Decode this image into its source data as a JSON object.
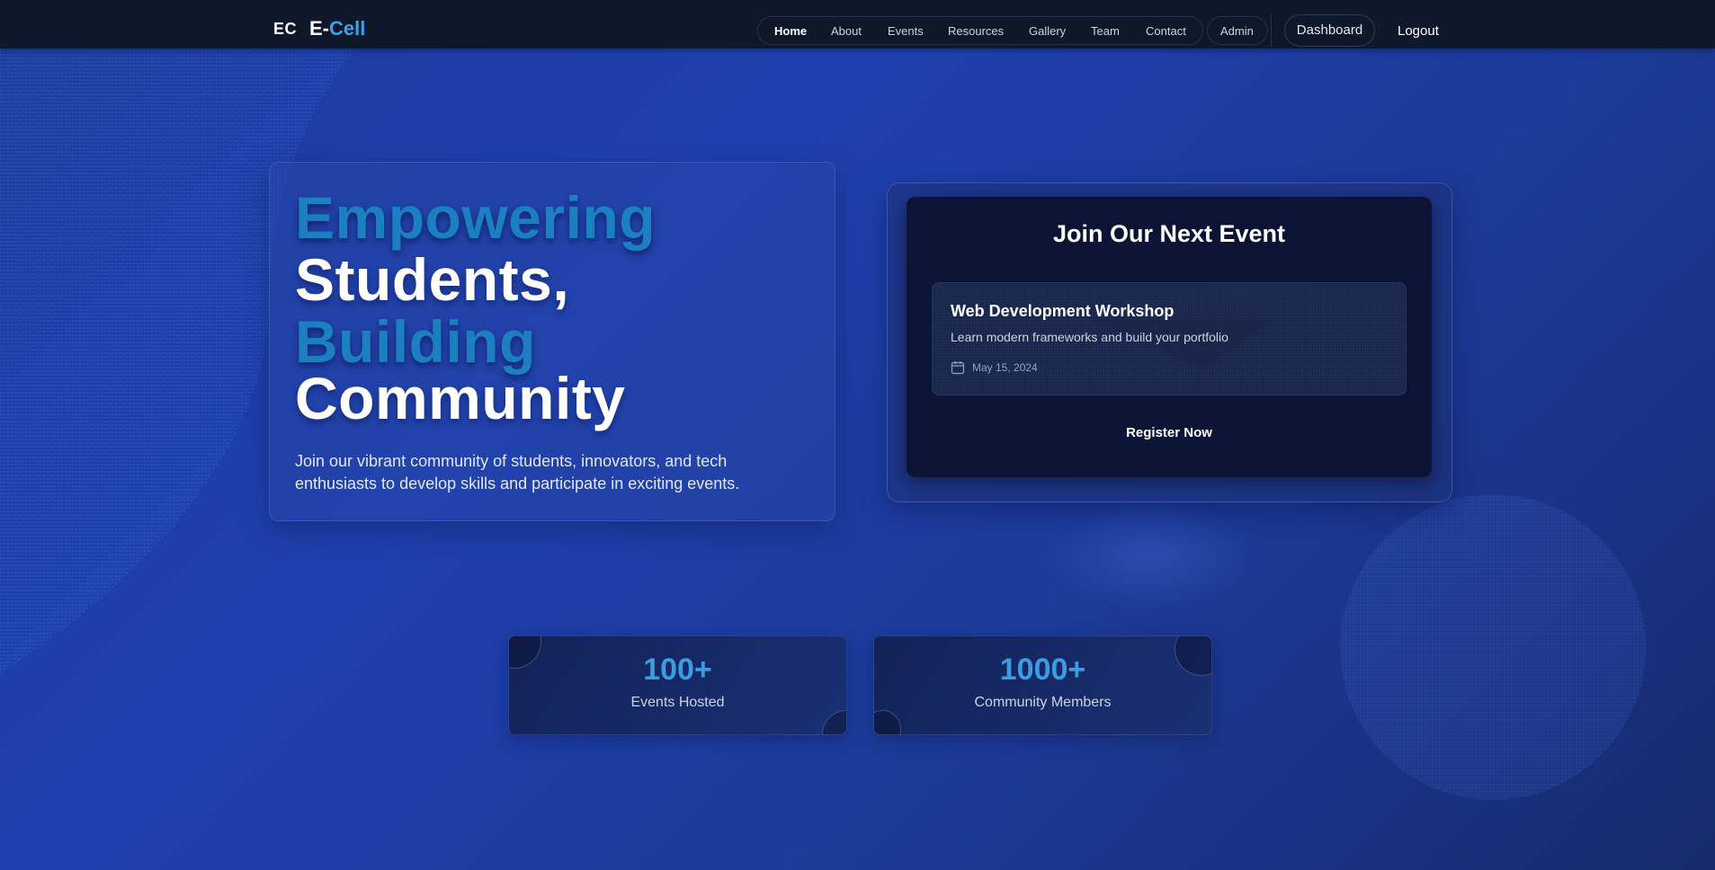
{
  "brand": {
    "mark": "EC",
    "name_prefix": "E-",
    "name_accent": "Cell"
  },
  "nav": {
    "links": [
      "Home",
      "About",
      "Events",
      "Resources",
      "Gallery",
      "Team",
      "Contact"
    ],
    "active": "Home",
    "admin_label": "Admin",
    "dashboard_label": "Dashboard",
    "logout_label": "Logout"
  },
  "hero": {
    "lines": [
      "Empowering",
      "Students,",
      "Building",
      "Community"
    ],
    "description": "Join our vibrant community of students, innovators, and tech enthusiasts to develop skills and participate in exciting events."
  },
  "event_panel": {
    "heading": "Join Our Next Event",
    "event": {
      "title": "Web Development Workshop",
      "subtitle": "Learn modern frameworks and build your portfolio",
      "date": "May 15, 2024",
      "date_icon": "calendar-icon"
    },
    "register_label": "Register Now"
  },
  "stats": [
    {
      "value": "100+",
      "label": "Events Hosted"
    },
    {
      "value": "1000+",
      "label": "Community Members"
    }
  ],
  "colors": {
    "background": "#1e40af",
    "navbar": "#0f172a",
    "accent": "#38a3e8",
    "hero_blue_text": "#1b7fc0",
    "panel_dark": "#0b1434"
  }
}
